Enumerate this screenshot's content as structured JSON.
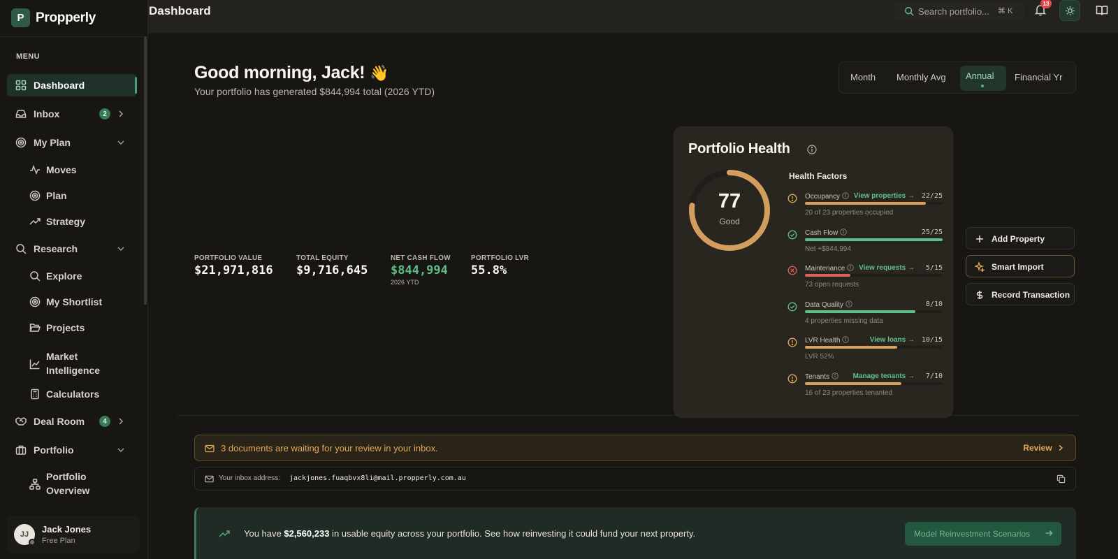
{
  "brand": {
    "logo_letter": "P",
    "name": "Propperly"
  },
  "sidebar": {
    "menu_heading": "MENU",
    "items": [
      {
        "label": "Dashboard"
      },
      {
        "label": "Inbox",
        "badge": "2"
      },
      {
        "label": "My Plan"
      },
      {
        "label": "Moves"
      },
      {
        "label": "Plan"
      },
      {
        "label": "Strategy"
      },
      {
        "label": "Research"
      },
      {
        "label": "Explore"
      },
      {
        "label": "My Shortlist"
      },
      {
        "label": "Projects"
      },
      {
        "label": "Market Intelligence"
      },
      {
        "label": "Calculators"
      },
      {
        "label": "Deal Room",
        "badge": "4"
      },
      {
        "label": "Portfolio"
      },
      {
        "label": "Portfolio Overview"
      }
    ],
    "user": {
      "initials": "JJ",
      "name": "Jack Jones",
      "plan": "Free Plan"
    }
  },
  "topbar": {
    "title": "Dashboard",
    "search_placeholder": "Search portfolio...",
    "search_shortcut": "⌘ K",
    "notifications_count": "13"
  },
  "main": {
    "greeting": "Good morning, Jack!",
    "greeting_emoji": "👋",
    "subtitle": "Your portfolio has generated $844,994 total (2026 YTD)",
    "period_tabs": [
      "Month",
      "Monthly Avg",
      "Annual",
      "Financial Yr"
    ],
    "active_period": "Annual",
    "metrics": [
      {
        "label": "PORTFOLIO VALUE",
        "value": "$21,971,816"
      },
      {
        "label": "TOTAL EQUITY",
        "value": "$9,716,645"
      },
      {
        "label": "NET CASH FLOW",
        "value": "$844,994",
        "sub": "2026 YTD"
      },
      {
        "label": "PORTFOLIO LVR",
        "value": "55.8%"
      }
    ]
  },
  "health": {
    "title": "Portfolio Health",
    "score": "77",
    "score_value": 0.77,
    "score_label": "Good",
    "factors_title": "Health Factors",
    "factors": [
      {
        "name": "Occupancy",
        "link": "View properties →",
        "score": "22/25",
        "sub": "20 of 23 properties occupied",
        "status": "warning",
        "fill": 0.88
      },
      {
        "name": "Cash Flow",
        "link": "",
        "score": "25/25",
        "sub": "Net +$844,994",
        "status": "good",
        "fill": 1.0
      },
      {
        "name": "Maintenance",
        "link": "View requests →",
        "score": "5/15",
        "sub": "73 open requests",
        "status": "bad",
        "fill": 0.33
      },
      {
        "name": "Data Quality",
        "link": "",
        "score": "8/10",
        "sub": "4 properties missing data",
        "status": "good",
        "fill": 0.8
      },
      {
        "name": "LVR Health",
        "link": "View loans →",
        "score": "10/15",
        "sub": "LVR 52%",
        "status": "warning",
        "fill": 0.67
      },
      {
        "name": "Tenants",
        "link": "Manage tenants →",
        "score": "7/10",
        "sub": "16 of 23 properties tenanted",
        "status": "warning",
        "fill": 0.7
      }
    ]
  },
  "actions": {
    "add_property": "Add Property",
    "smart_import": "Smart Import",
    "record_transaction": "Record Transaction"
  },
  "docs": {
    "message": "3 documents are waiting for your review in your inbox.",
    "review_label": "Review"
  },
  "inbox": {
    "label": "Your inbox address:",
    "address": "jackjones.fuaqbvx8li@mail.propperly.com.au"
  },
  "equity": {
    "prefix": "You have ",
    "amount": "$2,560,233",
    "suffix": " in usable equity across your portfolio. See how reinvesting it could fund your next property.",
    "button": "Model Reinvestment Scenarios"
  },
  "colors": {
    "accent_green": "#5ebd88",
    "warning": "#e1a85a",
    "danger": "#e0605a",
    "gauge": "#d39d5d"
  }
}
